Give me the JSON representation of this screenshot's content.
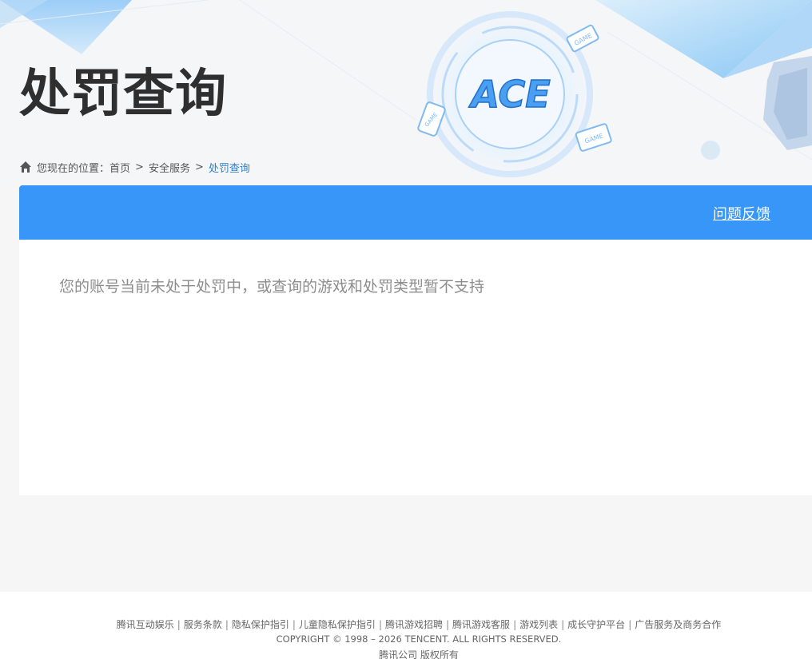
{
  "header": {
    "title": "处罚查询"
  },
  "breadcrumb": {
    "prefix": "您现在的位置：",
    "home": "首页",
    "separator": ">",
    "security": "安全服务",
    "current": "处罚查询"
  },
  "logo": {
    "text": "ACE",
    "badges": [
      "GAME",
      "GAME",
      "GAME"
    ]
  },
  "panel": {
    "feedback_label": "问题反馈",
    "message": "您的账号当前未处于处罚中，或查询的游戏和处罚类型暂不支持"
  },
  "footer": {
    "links": [
      "腾讯互动娱乐",
      "服务条款",
      "隐私保护指引",
      "儿童隐私保护指引",
      "腾讯游戏招聘",
      "腾讯游戏客服",
      "游戏列表",
      "成长守护平台",
      "广告服务及商务合作"
    ],
    "separator": "|",
    "copyright": "COPYRIGHT © 1998 – 2026 TENCENT. ALL RIGHTS RESERVED.",
    "company": "腾讯公司 版权所有"
  },
  "colors": {
    "accent": "#3796f7",
    "link_current": "#2f7fc7",
    "title": "#2f2f2f"
  }
}
